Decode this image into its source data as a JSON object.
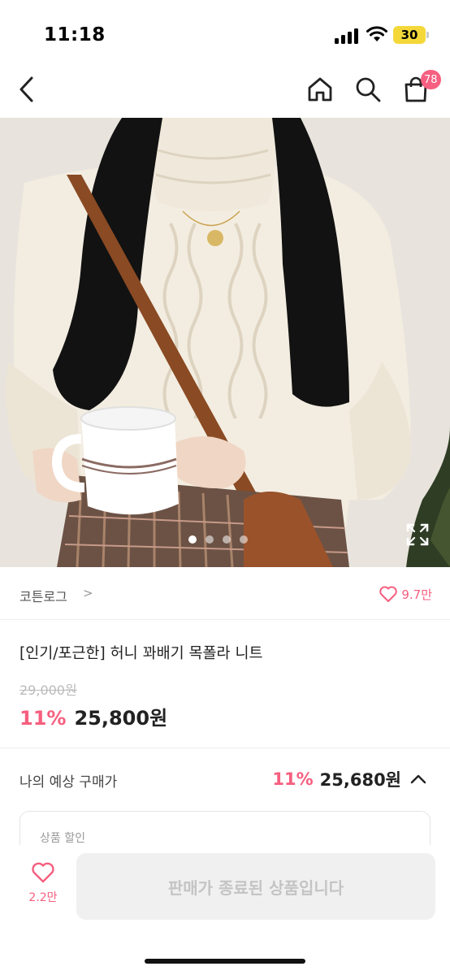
{
  "status_bar": {
    "time": "11:18",
    "battery": "30",
    "icons": [
      "signal-icon",
      "wifi-icon",
      "battery-icon"
    ]
  },
  "nav": {
    "icons": [
      "back-arrow-icon",
      "home-icon",
      "search-icon",
      "shopping-bag-icon"
    ],
    "cart_badge": "78"
  },
  "gallery": {
    "image_count": 4,
    "active_index": 0,
    "expand_icon": "expand-icon"
  },
  "brand": {
    "name": "코튼로그",
    "chevron": ">",
    "likes": "9.7만"
  },
  "product": {
    "title": "[인기/포근한] 허니 꽈배기 목폴라 니트",
    "original_price": "29,000원",
    "discount": "11%",
    "sale_price": "25,800원"
  },
  "expected": {
    "label": "나의 예상 구매가",
    "discount": "11%",
    "price": "25,680원",
    "chevron_icon": "chevron-up-icon",
    "coupon_label": "상품 할인"
  },
  "bottom_bar": {
    "fav_count": "2.2만",
    "buy_label": "판매가 종료된 상품입니다"
  },
  "colors": {
    "accent": "#f65f7f",
    "text": "#222222",
    "disabled_bg": "#f0f0f0",
    "disabled_text": "#c4c4c4"
  }
}
